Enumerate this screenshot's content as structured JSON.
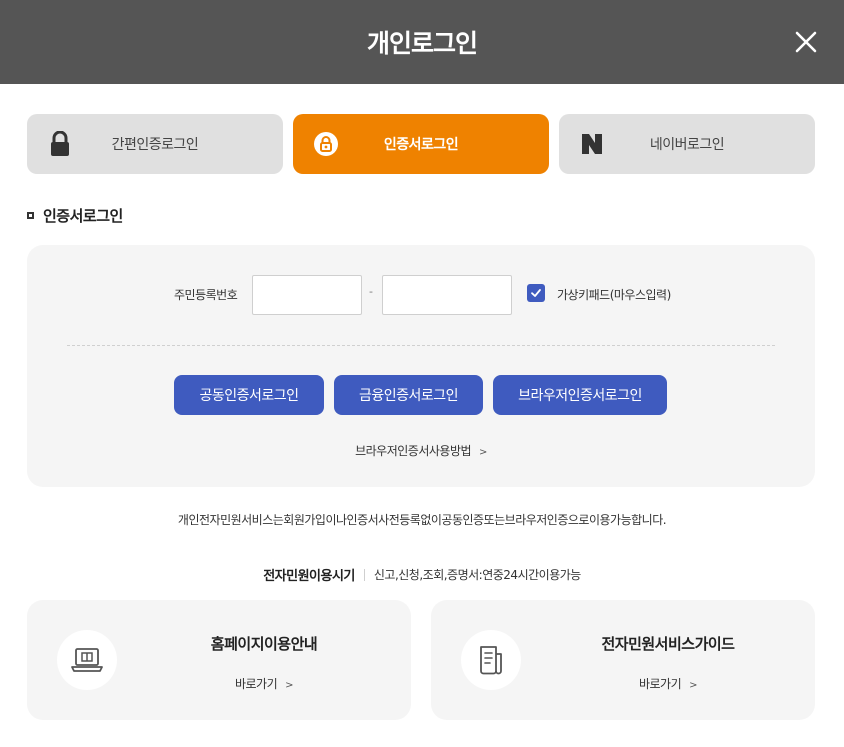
{
  "header": {
    "title": "개인로그인"
  },
  "tabs": [
    {
      "label": "간편인증로그인",
      "icon": "lock-icon",
      "active": false
    },
    {
      "label": "인증서로그인",
      "icon": "certificate-icon",
      "active": true
    },
    {
      "label": "네이버로그인",
      "icon": "naver-icon",
      "active": false
    }
  ],
  "section": {
    "title": "인증서로그인"
  },
  "form": {
    "rrn_label": "주민등록번호",
    "rrn_first_value": "",
    "rrn_second_value": "",
    "dash": "-",
    "virtual_keyboard_label": "가상키패드(마우스입력)",
    "virtual_keyboard_checked": true
  },
  "buttons": {
    "joint_cert": "공동인증서로그인",
    "financial_cert": "금융인증서로그인",
    "browser_cert": "브라우저인증서로그인"
  },
  "howto": {
    "label": "브라우저인증서사용방법"
  },
  "notice": "개인전자민원서비스는회원가입이나인증서사전등록없이공동인증또는브라우저인증으로이용가능합니다.",
  "hours": {
    "title": "전자민원이용시기",
    "text": "신고,신청,조회,증명서:연중24시간이용가능"
  },
  "cards": [
    {
      "title": "홈페이지이용안내",
      "link": "바로가기",
      "icon": "laptop-icon"
    },
    {
      "title": "전자민원서비스가이드",
      "link": "바로가기",
      "icon": "document-guide-icon"
    }
  ],
  "colors": {
    "header_bg": "#555555",
    "accent_orange": "#ef8200",
    "button_blue": "#3f5bbf",
    "panel_bg": "#f5f5f5",
    "tab_inactive": "#e0e0e0"
  }
}
